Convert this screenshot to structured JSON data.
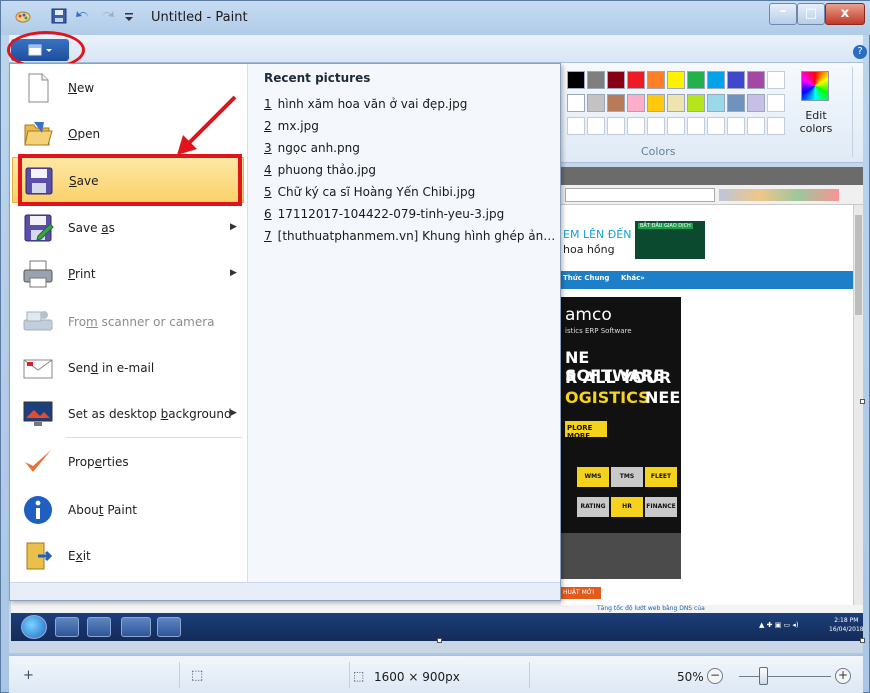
{
  "window": {
    "title": "Untitled - Paint",
    "controls": {
      "minimize": "–",
      "maximize": "□",
      "close": "x"
    }
  },
  "help": "?",
  "file_menu": {
    "items": [
      {
        "label_pre": "",
        "label_key": "N",
        "label_post": "ew",
        "icon": "new-document-icon"
      },
      {
        "label_pre": "",
        "label_key": "O",
        "label_post": "pen",
        "icon": "open-folder-icon"
      },
      {
        "label_pre": "",
        "label_key": "S",
        "label_post": "ave",
        "icon": "save-disk-icon"
      },
      {
        "label_pre": "Save ",
        "label_key": "a",
        "label_post": "s",
        "icon": "save-as-icon",
        "submenu": "▶"
      },
      {
        "label_pre": "",
        "label_key": "P",
        "label_post": "rint",
        "icon": "printer-icon",
        "submenu": "▶"
      },
      {
        "label_pre": "Fro",
        "label_key": "m",
        "label_post": " scanner or camera",
        "icon": "scanner-icon"
      },
      {
        "label_pre": "Sen",
        "label_key": "d",
        "label_post": " in e-mail",
        "icon": "email-icon"
      },
      {
        "label_pre": "Set as desktop ",
        "label_key": "b",
        "label_post": "ackground",
        "icon": "desktop-icon",
        "submenu": "▶"
      },
      {
        "label_pre": "Prop",
        "label_key": "e",
        "label_post": "rties",
        "icon": "checkmark-icon"
      },
      {
        "label_pre": "Abou",
        "label_key": "t",
        "label_post": " Paint",
        "icon": "info-icon"
      },
      {
        "label_pre": "E",
        "label_key": "x",
        "label_post": "it",
        "icon": "exit-icon"
      }
    ],
    "recent_title": "Recent pictures",
    "recent": [
      {
        "num": "1",
        "name": "hình xăm hoa văn ở vai đẹp.jpg"
      },
      {
        "num": "2",
        "name": "mx.jpg"
      },
      {
        "num": "3",
        "name": "ngọc anh.png"
      },
      {
        "num": "4",
        "name": "phuong thảo.jpg"
      },
      {
        "num": "5",
        "name": "Chữ ký ca sĩ Hoàng Yến Chibi.jpg"
      },
      {
        "num": "6",
        "name": "17112017-104422-079-tinh-yeu-3.jpg"
      },
      {
        "num": "7",
        "name": "[thuthuatphanmem.vn] Khung hình ghép ảnh cực đ..."
      }
    ]
  },
  "ribbon": {
    "colors_label": "Colors",
    "edit_colors_label": "Edit colors",
    "palette_row1": [
      "#000000",
      "#7f7f7f",
      "#880015",
      "#ed1c24",
      "#ff7f27",
      "#fff200",
      "#22b14c",
      "#00a2e8",
      "#3f48cc",
      "#a349a4"
    ],
    "palette_row2": [
      "#ffffff",
      "#c3c3c3",
      "#b97a57",
      "#ffaec9",
      "#ffc90e",
      "#efe4b0",
      "#b5e61d",
      "#99d9ea",
      "#7092be",
      "#c8bfe7"
    ]
  },
  "embedded_image": {
    "banner_line1": "EM LÊN ĐẾN",
    "banner_line2": "hoa hồng",
    "banner_badge": "BẮT ĐẦU GIAO DỊCH",
    "nav_1": "Thức Chung",
    "nav_2": "Khác»",
    "ad_logo": "amco",
    "ad_sub": "istics ERP Software",
    "ad_line1": "NE SOFTWARE",
    "ad_line2": "R ALL YOUR",
    "ad_line3_yellow": "OGISTICS",
    "ad_line3_white": "NEEDS",
    "ad_button": "PLORE MORE",
    "puzzle": [
      "WMS",
      "TMS",
      "FLEET",
      "RATING",
      "HR",
      "FINANCE"
    ],
    "section_tag": "HUẬT MỚI",
    "news": "Tăng tốc độ lướt web bằng DNS của",
    "clock_time": "2:18 PM",
    "clock_date": "16/04/2018"
  },
  "statusbar": {
    "move_icon": "+",
    "select_icon": "⬚",
    "size_text": "1600 × 900px",
    "zoom": "50%",
    "zoom_minus": "−",
    "zoom_plus": "+"
  }
}
